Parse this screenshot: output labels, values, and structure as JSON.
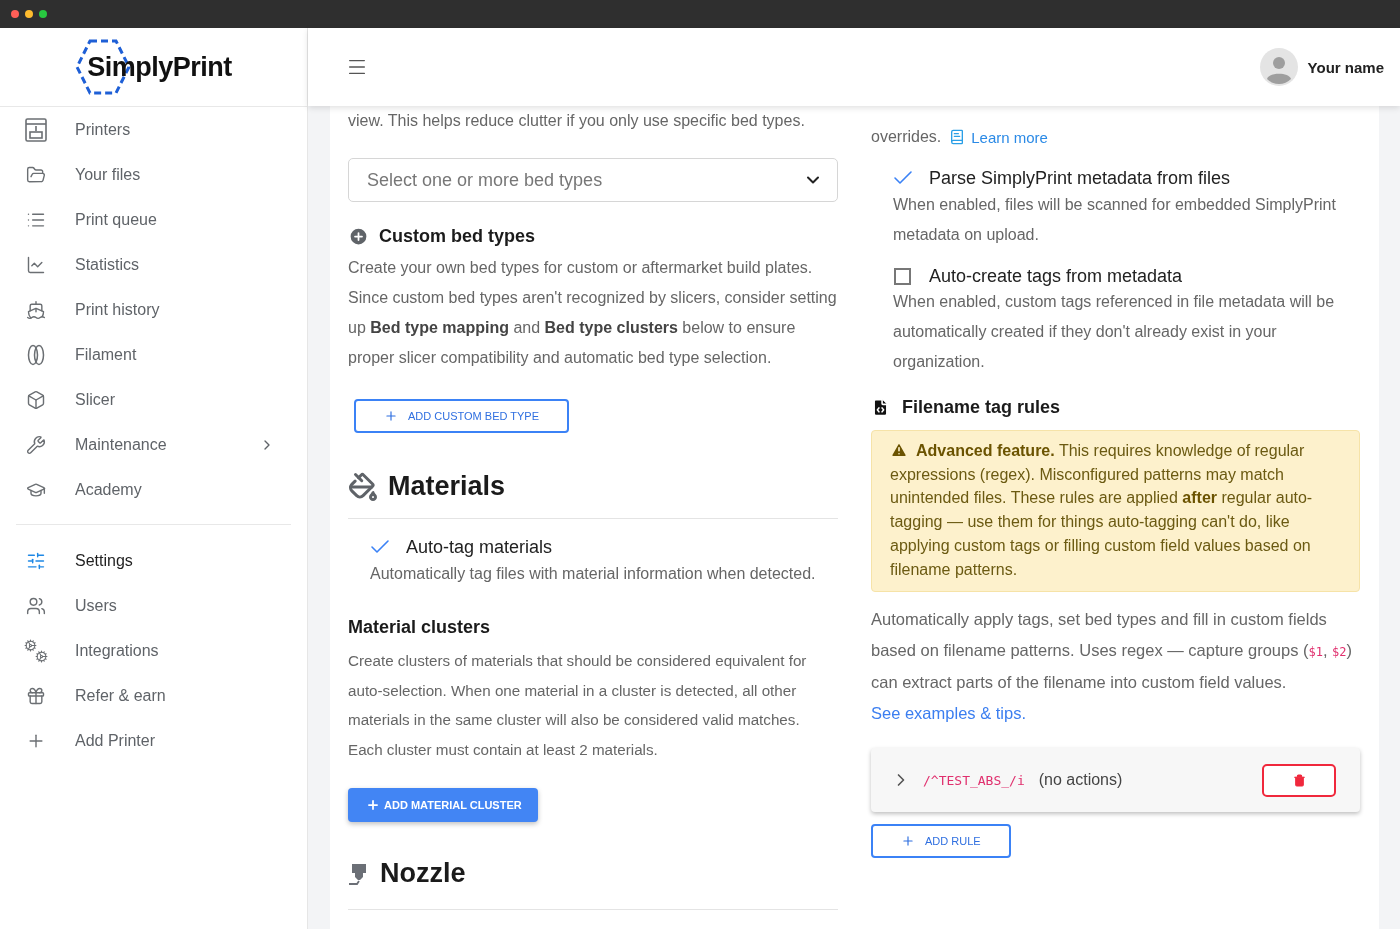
{
  "brand": {
    "name": "SimplyPrint"
  },
  "sidebar": {
    "groups": [
      {
        "items": [
          {
            "label": "Printers",
            "selected": false,
            "expandable": false
          },
          {
            "label": "Your files",
            "selected": false,
            "expandable": false
          },
          {
            "label": "Print queue",
            "selected": false,
            "expandable": false
          },
          {
            "label": "Statistics",
            "selected": false,
            "expandable": false
          },
          {
            "label": "Print history",
            "selected": false,
            "expandable": false
          },
          {
            "label": "Filament",
            "selected": false,
            "expandable": false
          },
          {
            "label": "Slicer",
            "selected": false,
            "expandable": false
          },
          {
            "label": "Maintenance",
            "selected": false,
            "expandable": true
          },
          {
            "label": "Academy",
            "selected": false,
            "expandable": false
          }
        ]
      },
      {
        "items": [
          {
            "label": "Settings",
            "selected": true,
            "expandable": false
          },
          {
            "label": "Users",
            "selected": false,
            "expandable": false
          },
          {
            "label": "Integrations",
            "selected": false,
            "expandable": false
          },
          {
            "label": "Refer & earn",
            "selected": false,
            "expandable": false
          },
          {
            "label": "Add Printer",
            "selected": false,
            "expandable": false
          }
        ]
      }
    ]
  },
  "header": {
    "user_name": "Your name"
  },
  "left_column": {
    "intro_tail": "view. This helps reduce clutter if you only use specific bed types.",
    "bed_type_select": {
      "placeholder": "Select one or more bed types"
    },
    "custom_bed_types": {
      "title": "Custom bed types",
      "description": "Create your own bed types for custom or aftermarket build plates. Since custom bed types aren't recognized by slicers, consider setting up **Bed type mapping** and **Bed type clusters** below to ensure proper slicer compatibility and automatic bed type selection.",
      "button": "ADD CUSTOM BED TYPE"
    },
    "materials": {
      "title": "Materials",
      "options": [
        {
          "label": "Auto-tag materials",
          "description": "Automatically tag files with material information when detected.",
          "checked": true
        }
      ]
    },
    "material_clusters": {
      "title": "Material clusters",
      "description": "Create clusters of materials that should be considered equivalent for auto-selection. When one material in a cluster is detected, all other materials in the same cluster will also be considered valid matches. Each cluster must contain at least 2 materials.",
      "button": "ADD MATERIAL CLUSTER"
    },
    "nozzle": {
      "title": "Nozzle"
    }
  },
  "right_column": {
    "intro_tail": "overrides.",
    "learn_more": "Learn more",
    "options": [
      {
        "label": "Parse SimplyPrint metadata from files",
        "description": "When enabled, files will be scanned for embedded SimplyPrint metadata on upload.",
        "checked": true
      },
      {
        "label": "Auto-create tags from metadata",
        "description": "When enabled, custom tags referenced in file metadata will be automatically created if they don't already exist in your organization.",
        "checked": false
      }
    ],
    "filename_tag_rules": {
      "title": "Filename tag rules",
      "warning": "**Advanced feature.** This requires knowledge of regular expressions (regex). Misconfigured patterns may match unintended files. These rules are applied **after** regular auto-tagging — use them for things auto-tagging can't do, like applying custom tags or filling custom field values based on filename patterns.",
      "description": [
        {
          "kind": "text",
          "text": "Automatically apply tags, set bed types and fill in custom fields based on filename patterns. Uses regex — capture groups ("
        },
        {
          "kind": "code",
          "text": "$1"
        },
        {
          "kind": "text",
          "text": ", "
        },
        {
          "kind": "code",
          "text": "$2"
        },
        {
          "kind": "text",
          "text": ") can extract parts of the filename into custom field values. "
        },
        {
          "kind": "link",
          "text": "See examples & tips."
        }
      ],
      "rules": [
        {
          "pattern": "/^TEST_ABS_/i",
          "summary": "(no actions)",
          "expanded": false
        }
      ],
      "add_button": "ADD RULE"
    }
  }
}
